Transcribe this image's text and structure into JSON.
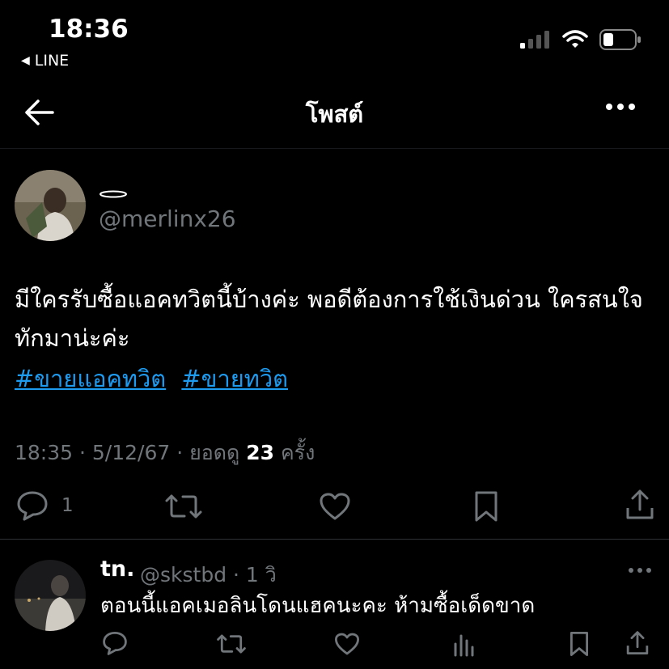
{
  "status_bar": {
    "time": "18:36",
    "back_app": "LINE"
  },
  "header": {
    "title": "โพสต์"
  },
  "post": {
    "handle": "@merlinx26",
    "text": "มีใครรับซื้อแอคทวิตนี้บ้างค่ะ พอดีต้องการใช้เงินด่วน ใครสนใจทักมาน่ะค่ะ",
    "hashtags": [
      "#ขายแอคทวิต",
      "#ขายทวิต"
    ],
    "meta_time": "18:35 · 5/12/67 · ยอดดู",
    "views": "23",
    "views_suffix": "ครั้ง",
    "reply_count": "1"
  },
  "reply": {
    "name": "tn.",
    "handle_time": "@skstbd · 1 วิ",
    "text": "ตอนนี้แอคเมอลินโดนแฮคนะคะ ห้ามซื้อเด็ดขาด"
  },
  "colors": {
    "accent": "#1d9bf0",
    "muted": "#71767b",
    "background": "#000000"
  }
}
